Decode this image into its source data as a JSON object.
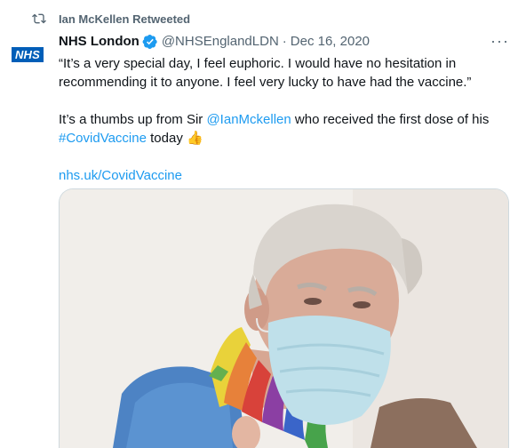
{
  "retweet": {
    "icon": "retweet-icon",
    "label": "Ian McKellen Retweeted"
  },
  "author": {
    "avatar_text": "NHS",
    "display_name": "NHS London",
    "verified_icon": "verified-badge-icon",
    "handle": "@NHSEnglandLDN",
    "separator": "·",
    "date": "Dec 16, 2020"
  },
  "more_label": "···",
  "body": {
    "quote": "“It’s a very special day, I feel euphoric. I would have no hesitation in recommending it to anyone. I feel very lucky to have had the vaccine.”",
    "p2_prefix": "It’s a thumbs up from Sir ",
    "mention": "@IanMckellen",
    "p2_middle": " who received the first dose of his ",
    "hashtag": "#CovidVaccine",
    "p2_suffix": " today ",
    "emoji": "👍",
    "url": "nhs.uk/CovidVaccine"
  },
  "media": {
    "alt": "Photo of Sir Ian McKellen wearing a face mask and rainbow scarf"
  },
  "colors": {
    "link": "#1d9bf0",
    "muted": "#536471",
    "nhs_blue": "#005eb8",
    "verified": "#1d9bf0"
  }
}
